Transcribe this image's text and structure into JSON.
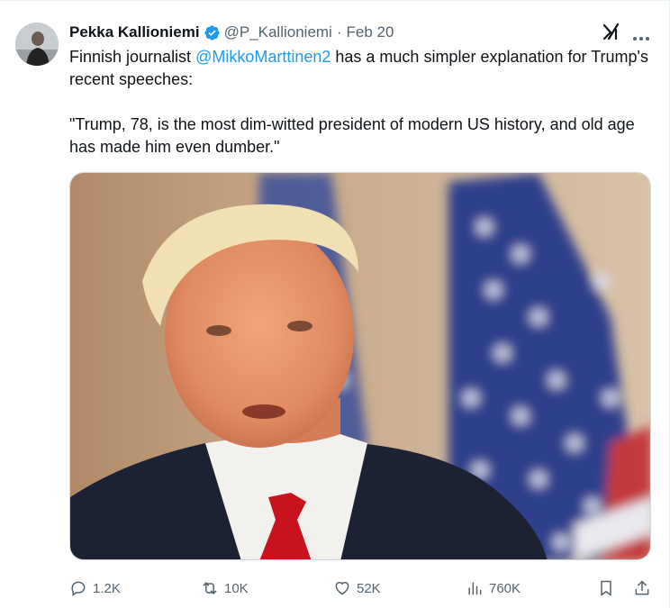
{
  "author": {
    "name": "Pekka Kallioniemi",
    "handle": "@P_Kallioniemi",
    "separator": "·",
    "date": "Feb 20"
  },
  "tweet": {
    "line1_before": "Finnish journalist ",
    "mention": "@MikkoMarttinen2",
    "line1_after": " has a much simpler explanation for Trump's recent speeches:",
    "quote": "\"Trump, 78, is the most dim-witted president of modern US history, and old age has made him even dumber.\""
  },
  "stats": {
    "replies": "1.2K",
    "reposts": "10K",
    "likes": "52K",
    "views": "760K"
  },
  "icons": {
    "verified": "verified-badge-icon",
    "grok": "grok-icon",
    "more": "more-options-icon",
    "reply": "reply-icon",
    "repost": "repost-icon",
    "like": "heart-icon",
    "views": "views-bar-chart-icon",
    "bookmark": "bookmark-icon",
    "share": "share-icon"
  },
  "colors": {
    "verified": "#1d9bf0",
    "mention": "#1d9bf0",
    "muted": "#536471",
    "text": "#0f1419"
  }
}
